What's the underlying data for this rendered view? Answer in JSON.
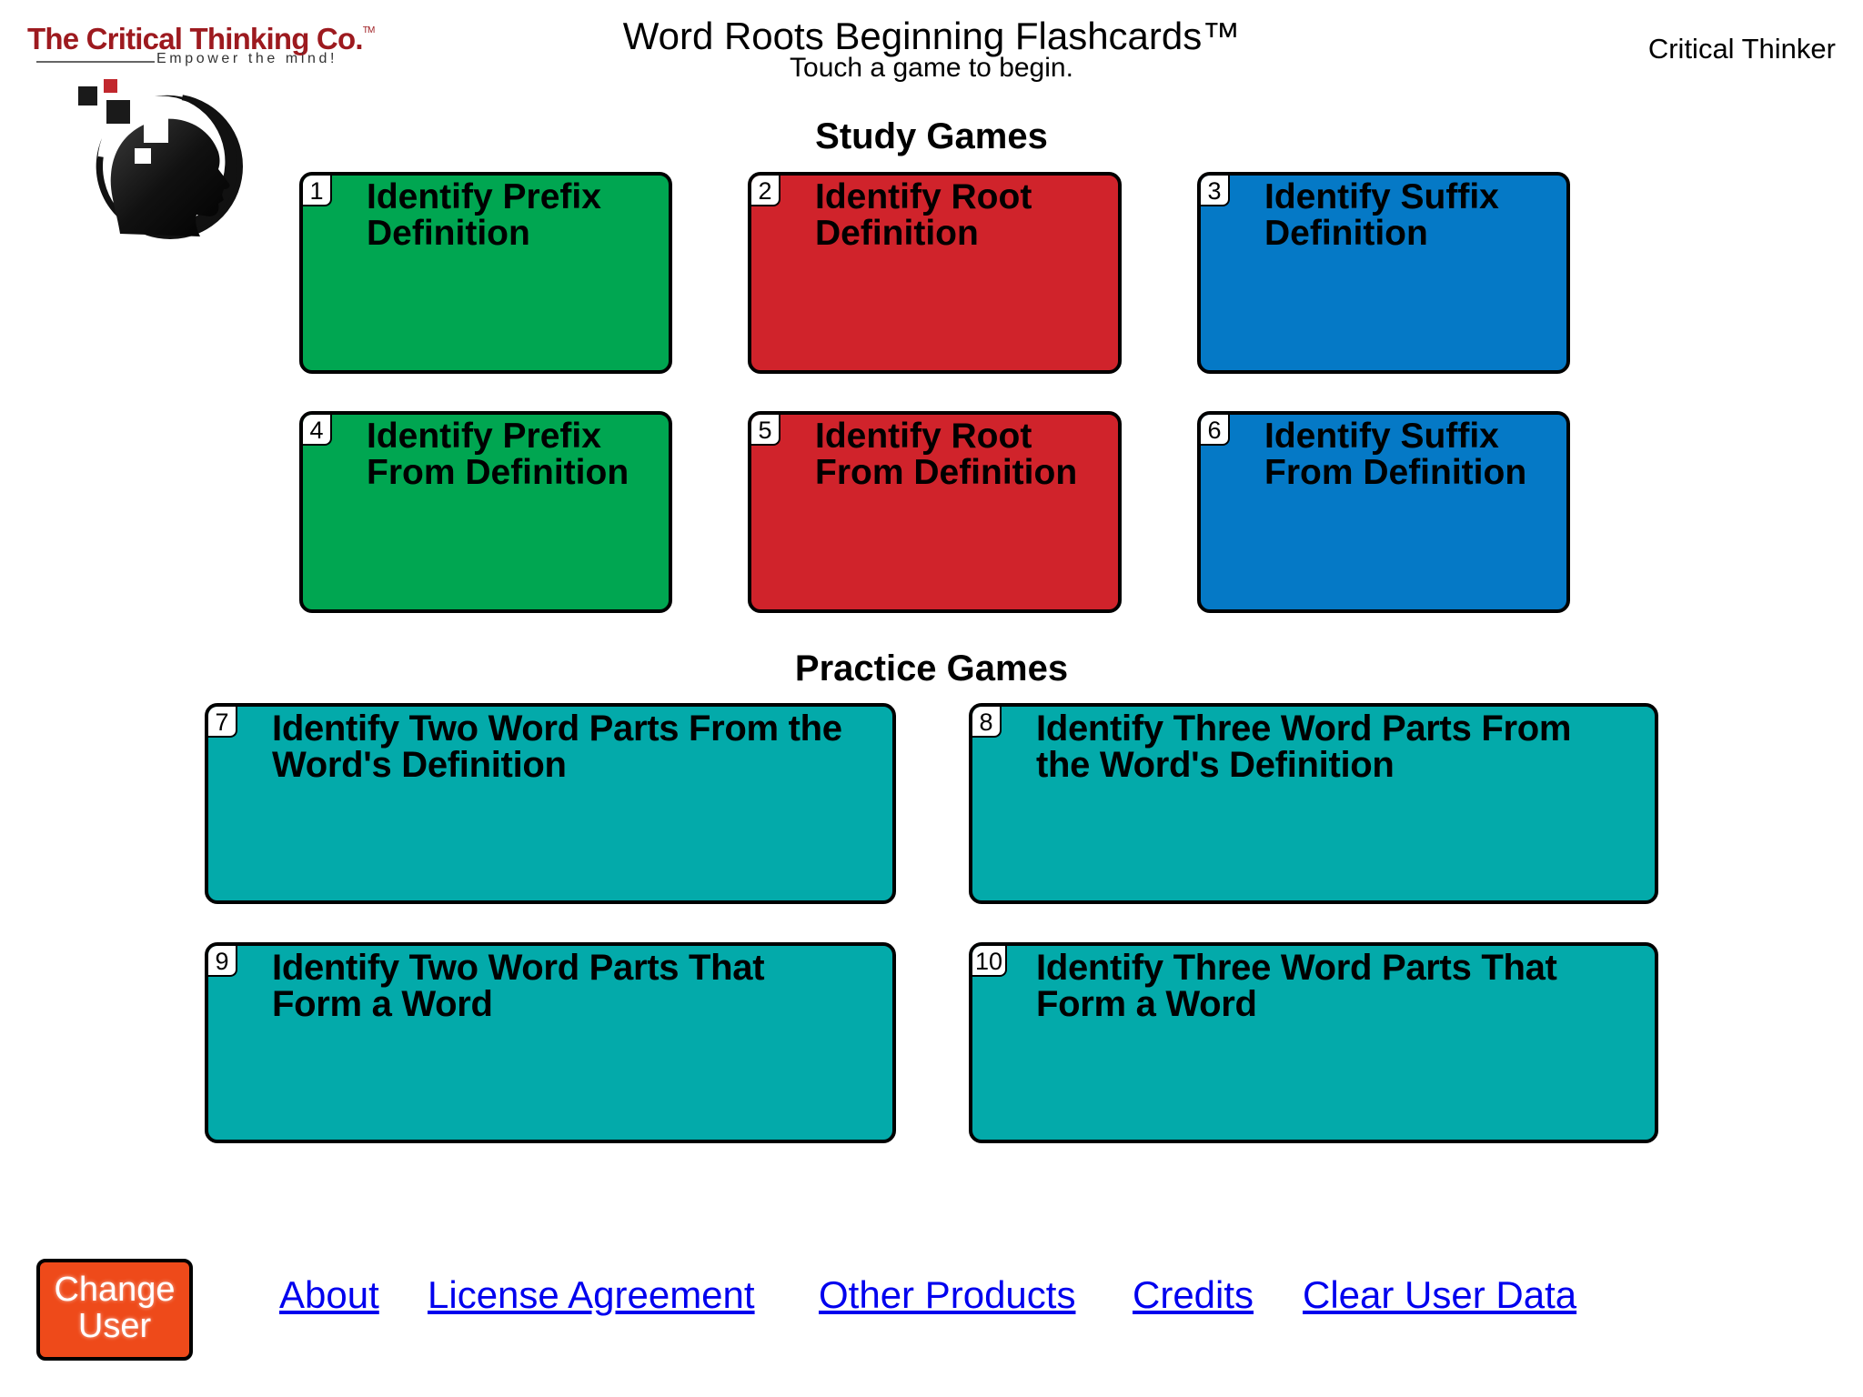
{
  "brand": {
    "name": "The Critical Thinking Co.",
    "trademark": "TM",
    "tagline": "Empower the mind!"
  },
  "header": {
    "title": "Word Roots Beginning Flashcards™",
    "subtitle": "Touch a game to begin.",
    "user_name": "Critical Thinker"
  },
  "study_games": {
    "heading": "Study Games",
    "cards": [
      {
        "number": "1",
        "label": "Identify Prefix Definition",
        "color": "#00a651"
      },
      {
        "number": "2",
        "label": "Identify Root Definition",
        "color": "#d0232b"
      },
      {
        "number": "3",
        "label": "Identify Suffix Definition",
        "color": "#0579c6"
      },
      {
        "number": "4",
        "label": "Identify Prefix From Definition",
        "color": "#00a651"
      },
      {
        "number": "5",
        "label": "Identify Root From Definition",
        "color": "#d0232b"
      },
      {
        "number": "6",
        "label": "Identify Suffix From Definition",
        "color": "#0579c6"
      }
    ]
  },
  "practice_games": {
    "heading": "Practice Games",
    "cards": [
      {
        "number": "7",
        "label": "Identify Two Word Parts From the Word's Definition",
        "color": "#03aaaa"
      },
      {
        "number": "8",
        "label": "Identify Three Word Parts From the Word's Definition",
        "color": "#03aaaa"
      },
      {
        "number": "9",
        "label": "Identify Two Word Parts That Form a Word",
        "color": "#03aaaa"
      },
      {
        "number": "10",
        "label": "Identify Three Word Parts That Form a Word",
        "color": "#03aaaa"
      }
    ]
  },
  "footer": {
    "change_user_label": "Change User",
    "change_user_color": "#ee4a1a",
    "links": [
      "About",
      "License Agreement",
      "Other Products",
      "Credits",
      "Clear User Data"
    ],
    "link_color": "#0000ee"
  }
}
